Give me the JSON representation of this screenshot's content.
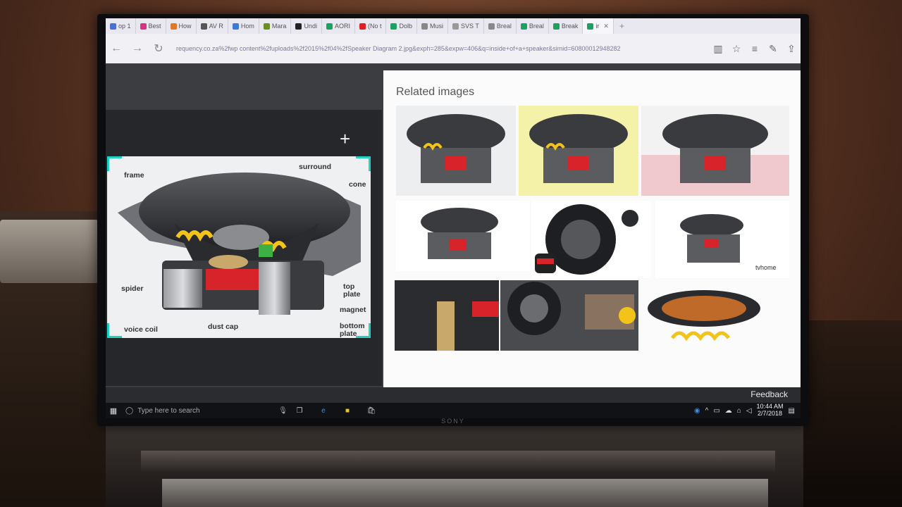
{
  "browser": {
    "tabs": [
      {
        "label": "op 1",
        "color": "#4a6fd6"
      },
      {
        "label": "Best",
        "color": "#d63384"
      },
      {
        "label": "How",
        "color": "#e0782a"
      },
      {
        "label": "AV R",
        "color": "#555555"
      },
      {
        "label": "Hom",
        "color": "#3a7bd5"
      },
      {
        "label": "Mara",
        "color": "#6b8e23"
      },
      {
        "label": "Undi",
        "color": "#222222"
      },
      {
        "label": "AORI",
        "color": "#1aa260"
      },
      {
        "label": "(No t",
        "color": "#e02020"
      },
      {
        "label": "Dolb",
        "color": "#1aa260"
      },
      {
        "label": "Musi",
        "color": "#888888"
      },
      {
        "label": "SVS T",
        "color": "#999999"
      },
      {
        "label": "Breal",
        "color": "#888888"
      },
      {
        "label": "Breal",
        "color": "#1aa260"
      },
      {
        "label": "Break",
        "color": "#1aa260"
      },
      {
        "label": "ir",
        "color": "#1aa260"
      }
    ],
    "url": "requency.co.za%2fwp content%2fuploads%2f2015%2f04%2fSpeaker Diagram 2.jpg&exph=285&expw=406&q=inside+of+a+speaker&simid=60800012948282",
    "icons": {
      "back": "back-arrow-icon",
      "forward": "forward-arrow-icon",
      "refresh": "refresh-icon",
      "reading": "reading-view-icon",
      "favorite": "star-icon",
      "hub": "hub-icon",
      "notes": "web-note-icon",
      "share": "share-icon"
    }
  },
  "viewer": {
    "close_label": "✕",
    "add_label": "+",
    "diagram_labels": {
      "frame": "frame",
      "surround": "surround",
      "cone": "cone",
      "spider": "spider",
      "top_plate": "top\nplate",
      "magnet": "magnet",
      "bottom_plate": "bottom\nplate",
      "voice_coil": "voice coil",
      "dust_cap": "dust cap"
    },
    "related_title": "Related images",
    "watermark": "tvhome",
    "feedback": "Feedback"
  },
  "taskbar": {
    "search_placeholder": "Type here to search",
    "time": "10:44 AM",
    "date": "2/7/2018"
  },
  "tv": {
    "brand": "SONY"
  },
  "colors": {
    "crop_handles": "#22d3c2",
    "cone_red": "#d8232a",
    "coil_yellow": "#f2c41a"
  }
}
